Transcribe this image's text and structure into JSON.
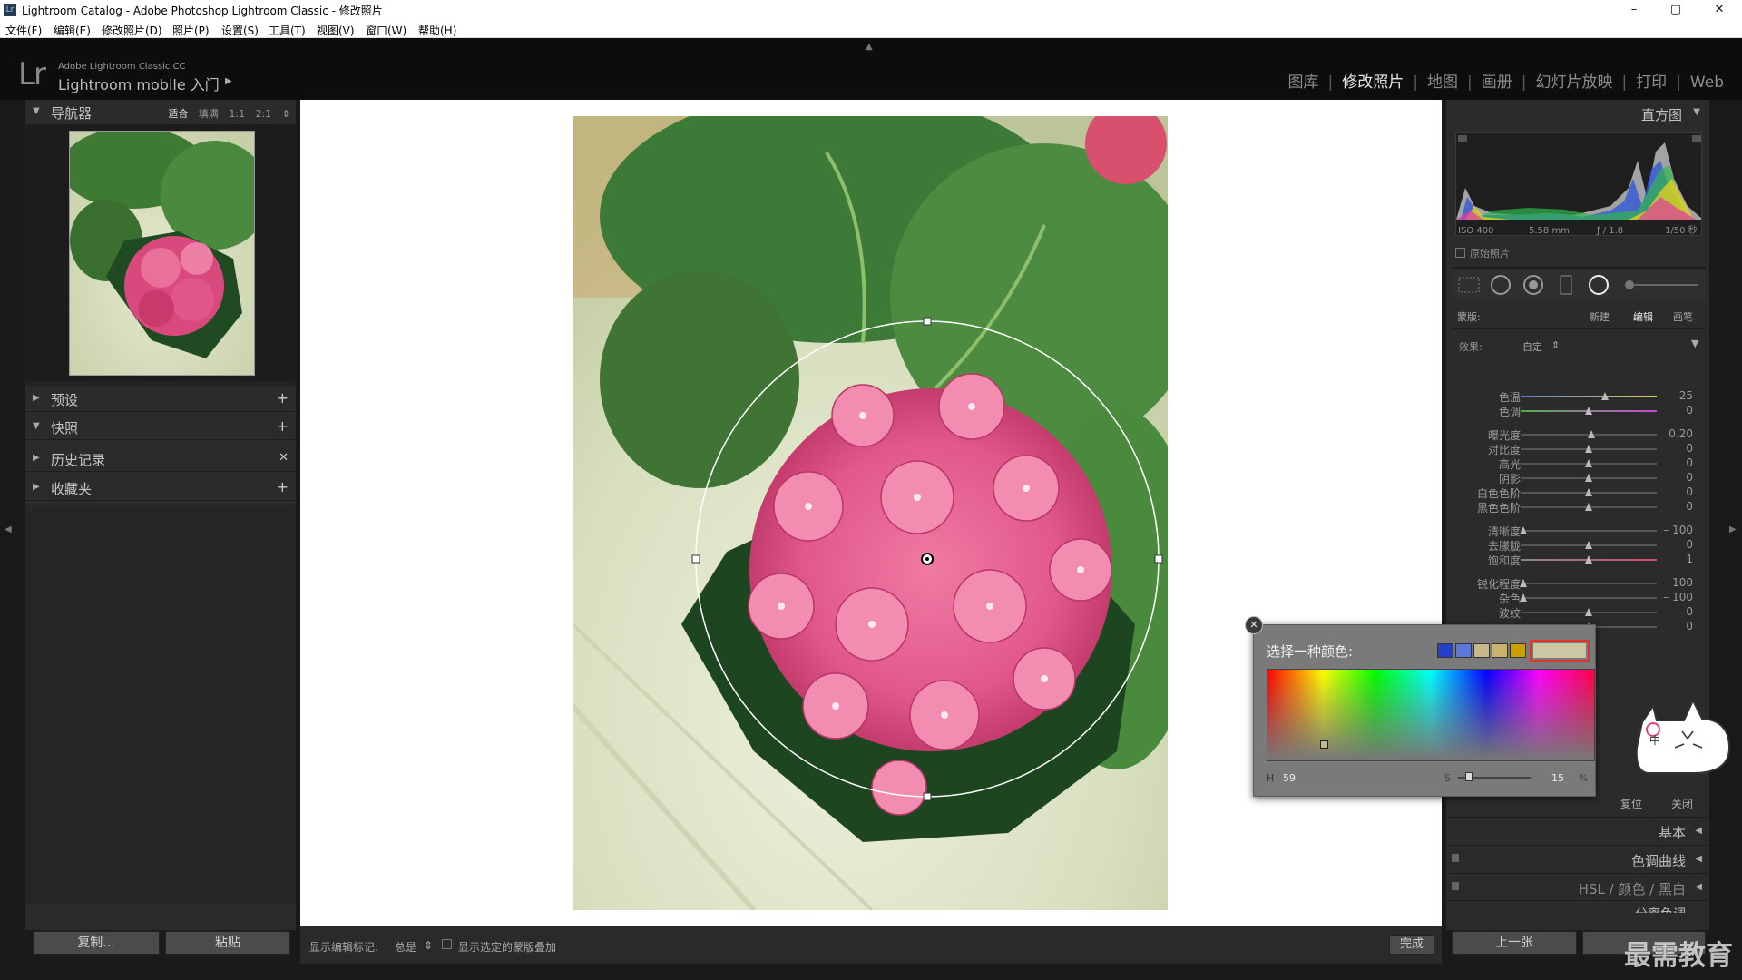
{
  "window": {
    "title": "Lightroom Catalog - Adobe Photoshop Lightroom Classic - 修改照片",
    "app_icon": "Lr",
    "minimize": "–",
    "maximize": "▢",
    "close": "✕"
  },
  "menubar": [
    "文件(F)",
    "编辑(E)",
    "修改照片(D)",
    "照片(P)",
    "设置(S)",
    "工具(T)",
    "视图(V)",
    "窗口(W)",
    "帮助(H)"
  ],
  "header": {
    "logo": "Lr",
    "product_line1": "Adobe Lightroom Classic CC",
    "product_line2": "Lightroom mobile 入门",
    "modules": [
      "图库",
      "修改照片",
      "地图",
      "画册",
      "幻灯片放映",
      "打印",
      "Web"
    ],
    "active_module": "修改照片"
  },
  "left_panel": {
    "navigator": {
      "label": "导航器",
      "zoom": [
        "适合",
        "填满",
        "1:1",
        "2:1"
      ]
    },
    "sections": [
      {
        "label": "预设",
        "action": "+"
      },
      {
        "label": "快照",
        "action": "+"
      },
      {
        "label": "历史记录",
        "action": "✕"
      },
      {
        "label": "收藏夹",
        "action": "+"
      }
    ],
    "copy_button": "复制...",
    "paste_button": "粘贴"
  },
  "toolbar": {
    "show_markers_label": "显示编辑标记:",
    "show_markers_value": "总是",
    "overlay_label": "显示选定的蒙版叠加",
    "done_button": "完成"
  },
  "right_panel": {
    "histogram_label": "直方图",
    "iso": "ISO 400",
    "focal": "5.58 mm",
    "aperture": "ƒ / 1.8",
    "shutter": "1/50 秒",
    "original_photo": "原始照片",
    "mask_label": "蒙版:",
    "mask_new": "新建",
    "mask_edit": "编辑",
    "mask_brush": "画笔",
    "effect_label": "效果:",
    "effect_value": "自定",
    "sliders": [
      {
        "label": "色温",
        "value": "25"
      },
      {
        "label": "色调",
        "value": "0"
      },
      {
        "label": "曝光度",
        "value": "0.20"
      },
      {
        "label": "对比度",
        "value": "0"
      },
      {
        "label": "高光",
        "value": "0"
      },
      {
        "label": "阴影",
        "value": "0"
      },
      {
        "label": "白色色阶",
        "value": "0"
      },
      {
        "label": "黑色色阶",
        "value": "0"
      },
      {
        "label": "清晰度",
        "value": "– 100"
      },
      {
        "label": "去朦胧",
        "value": "0"
      },
      {
        "label": "饱和度",
        "value": "1"
      },
      {
        "label": "锐化程度",
        "value": "– 100"
      },
      {
        "label": "杂色",
        "value": "– 100"
      },
      {
        "label": "波纹",
        "value": "0"
      },
      {
        "label": "",
        "value": "0"
      }
    ],
    "reset_button": "复位",
    "close_button": "关闭",
    "sections": [
      "基本",
      "色调曲线",
      "HSL / 颜色 / 黑白",
      "分离色调"
    ],
    "prev_button": "上一张"
  },
  "color_picker": {
    "title": "选择一种颜色:",
    "h_label": "H",
    "h_value": "59",
    "s_label": "S",
    "s_value": "15",
    "percent": "%",
    "swatches": [
      "#2440c8",
      "#5a78d8",
      "#c8b888",
      "#c9b26a",
      "#c8a000"
    ],
    "selected_color": "#cdc6a5"
  },
  "ime": {
    "label": "中"
  },
  "watermark": "最需教育"
}
